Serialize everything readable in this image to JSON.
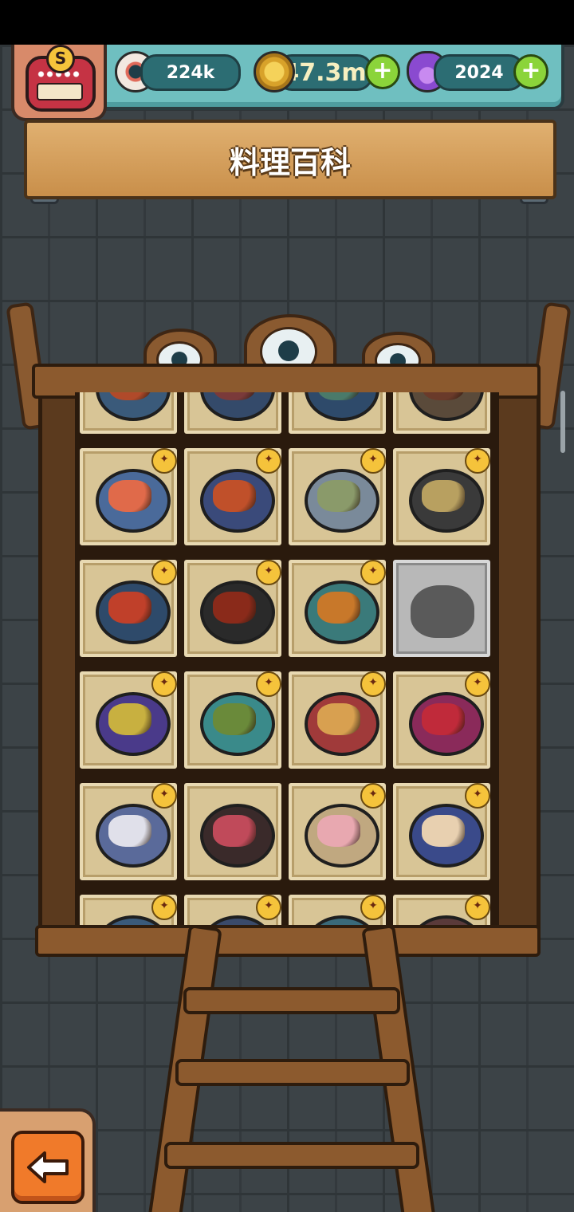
{
  "header": {
    "title": "料理百科",
    "rank_letter": "S"
  },
  "resources": {
    "eyeballs": "224k",
    "coins": "47.3m",
    "potions": "2024",
    "plus_symbol": "+"
  },
  "icons": {
    "eyeball": "eyeball-icon",
    "coin": "coin-icon",
    "potion": "potion-icon",
    "plus": "plus-icon",
    "back": "back-arrow-icon",
    "crown": "crown-icon"
  },
  "colors": {
    "topbar": "#6fbfc0",
    "plank": "#d8a35d",
    "tile": "#d8c596",
    "plus": "#8bd43a",
    "back_button": "#f07a2a"
  },
  "recipes": [
    {
      "food": "#b04a2a",
      "plate": "#3a5a7a",
      "crowned": false,
      "locked": false
    },
    {
      "food": "#7a3a3a",
      "plate": "#344a6a",
      "crowned": false,
      "locked": false
    },
    {
      "food": "#4a7a6a",
      "plate": "#2e4a6a",
      "crowned": false,
      "locked": false
    },
    {
      "food": "#6a3a2a",
      "plate": "#5a4a3a",
      "crowned": false,
      "locked": false
    },
    {
      "food": "#e06a4a",
      "plate": "#4a6a9a",
      "crowned": true,
      "locked": false
    },
    {
      "food": "#c0502a",
      "plate": "#3a4a7a",
      "crowned": true,
      "locked": false
    },
    {
      "food": "#8a9a6a",
      "plate": "#7a8a9a",
      "crowned": true,
      "locked": false
    },
    {
      "food": "#b8a060",
      "plate": "#3a3a3a",
      "crowned": true,
      "locked": false
    },
    {
      "food": "#c0402a",
      "plate": "#2e4a6a",
      "crowned": true,
      "locked": false
    },
    {
      "food": "#8a2a1a",
      "plate": "#2a2a2a",
      "crowned": true,
      "locked": false
    },
    {
      "food": "#c8782a",
      "plate": "#3a7a7a",
      "crowned": true,
      "locked": false
    },
    {
      "food": "",
      "plate": "",
      "crowned": false,
      "locked": true
    },
    {
      "food": "#c8b040",
      "plate": "#4a3a8a",
      "crowned": true,
      "locked": false
    },
    {
      "food": "#6a8a3a",
      "plate": "#3a8a8a",
      "crowned": true,
      "locked": false
    },
    {
      "food": "#d8a050",
      "plate": "#a03a3a",
      "crowned": true,
      "locked": false
    },
    {
      "food": "#c02a3a",
      "plate": "#8a2a5a",
      "crowned": true,
      "locked": false
    },
    {
      "food": "#e0e0ea",
      "plate": "#5a6a9a",
      "crowned": true,
      "locked": false
    },
    {
      "food": "#c04a5a",
      "plate": "#3a2a2a",
      "crowned": false,
      "locked": false
    },
    {
      "food": "#e8a8b0",
      "plate": "#c0a880",
      "crowned": true,
      "locked": false
    },
    {
      "food": "#e8d0b0",
      "plate": "#3a4a8a",
      "crowned": true,
      "locked": false
    },
    {
      "food": "#b07a3a",
      "plate": "#3a5a7a",
      "crowned": true,
      "locked": false
    },
    {
      "food": "#a04a2a",
      "plate": "#3a4a6a",
      "crowned": true,
      "locked": false
    },
    {
      "food": "#6a7a4a",
      "plate": "#3a6a7a",
      "crowned": true,
      "locked": false
    },
    {
      "food": "#c05a3a",
      "plate": "#5a3a3a",
      "crowned": true,
      "locked": false
    }
  ]
}
